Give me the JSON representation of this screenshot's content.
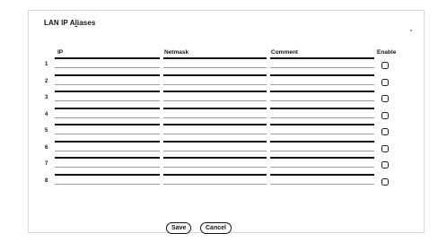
{
  "section": {
    "title_main": "LAN IP A",
    "title_underlined": "l",
    "title_rest": "iases"
  },
  "columns": {
    "ip": "IP",
    "netmask": "Netmask",
    "comment": "Comment",
    "enable": "Enable"
  },
  "rows": [
    {
      "index": "1",
      "ip": "",
      "netmask": "",
      "comment": "",
      "enabled": false
    },
    {
      "index": "2",
      "ip": "",
      "netmask": "",
      "comment": "",
      "enabled": false
    },
    {
      "index": "3",
      "ip": "",
      "netmask": "",
      "comment": "",
      "enabled": false
    },
    {
      "index": "4",
      "ip": "",
      "netmask": "",
      "comment": "",
      "enabled": false
    },
    {
      "index": "5",
      "ip": "",
      "netmask": "",
      "comment": "",
      "enabled": false
    },
    {
      "index": "6",
      "ip": "",
      "netmask": "",
      "comment": "",
      "enabled": false
    },
    {
      "index": "7",
      "ip": "",
      "netmask": "",
      "comment": "",
      "enabled": false
    },
    {
      "index": "8",
      "ip": "",
      "netmask": "",
      "comment": "",
      "enabled": false
    }
  ],
  "actions": {
    "save": "Save",
    "cancel": "Cancel"
  }
}
